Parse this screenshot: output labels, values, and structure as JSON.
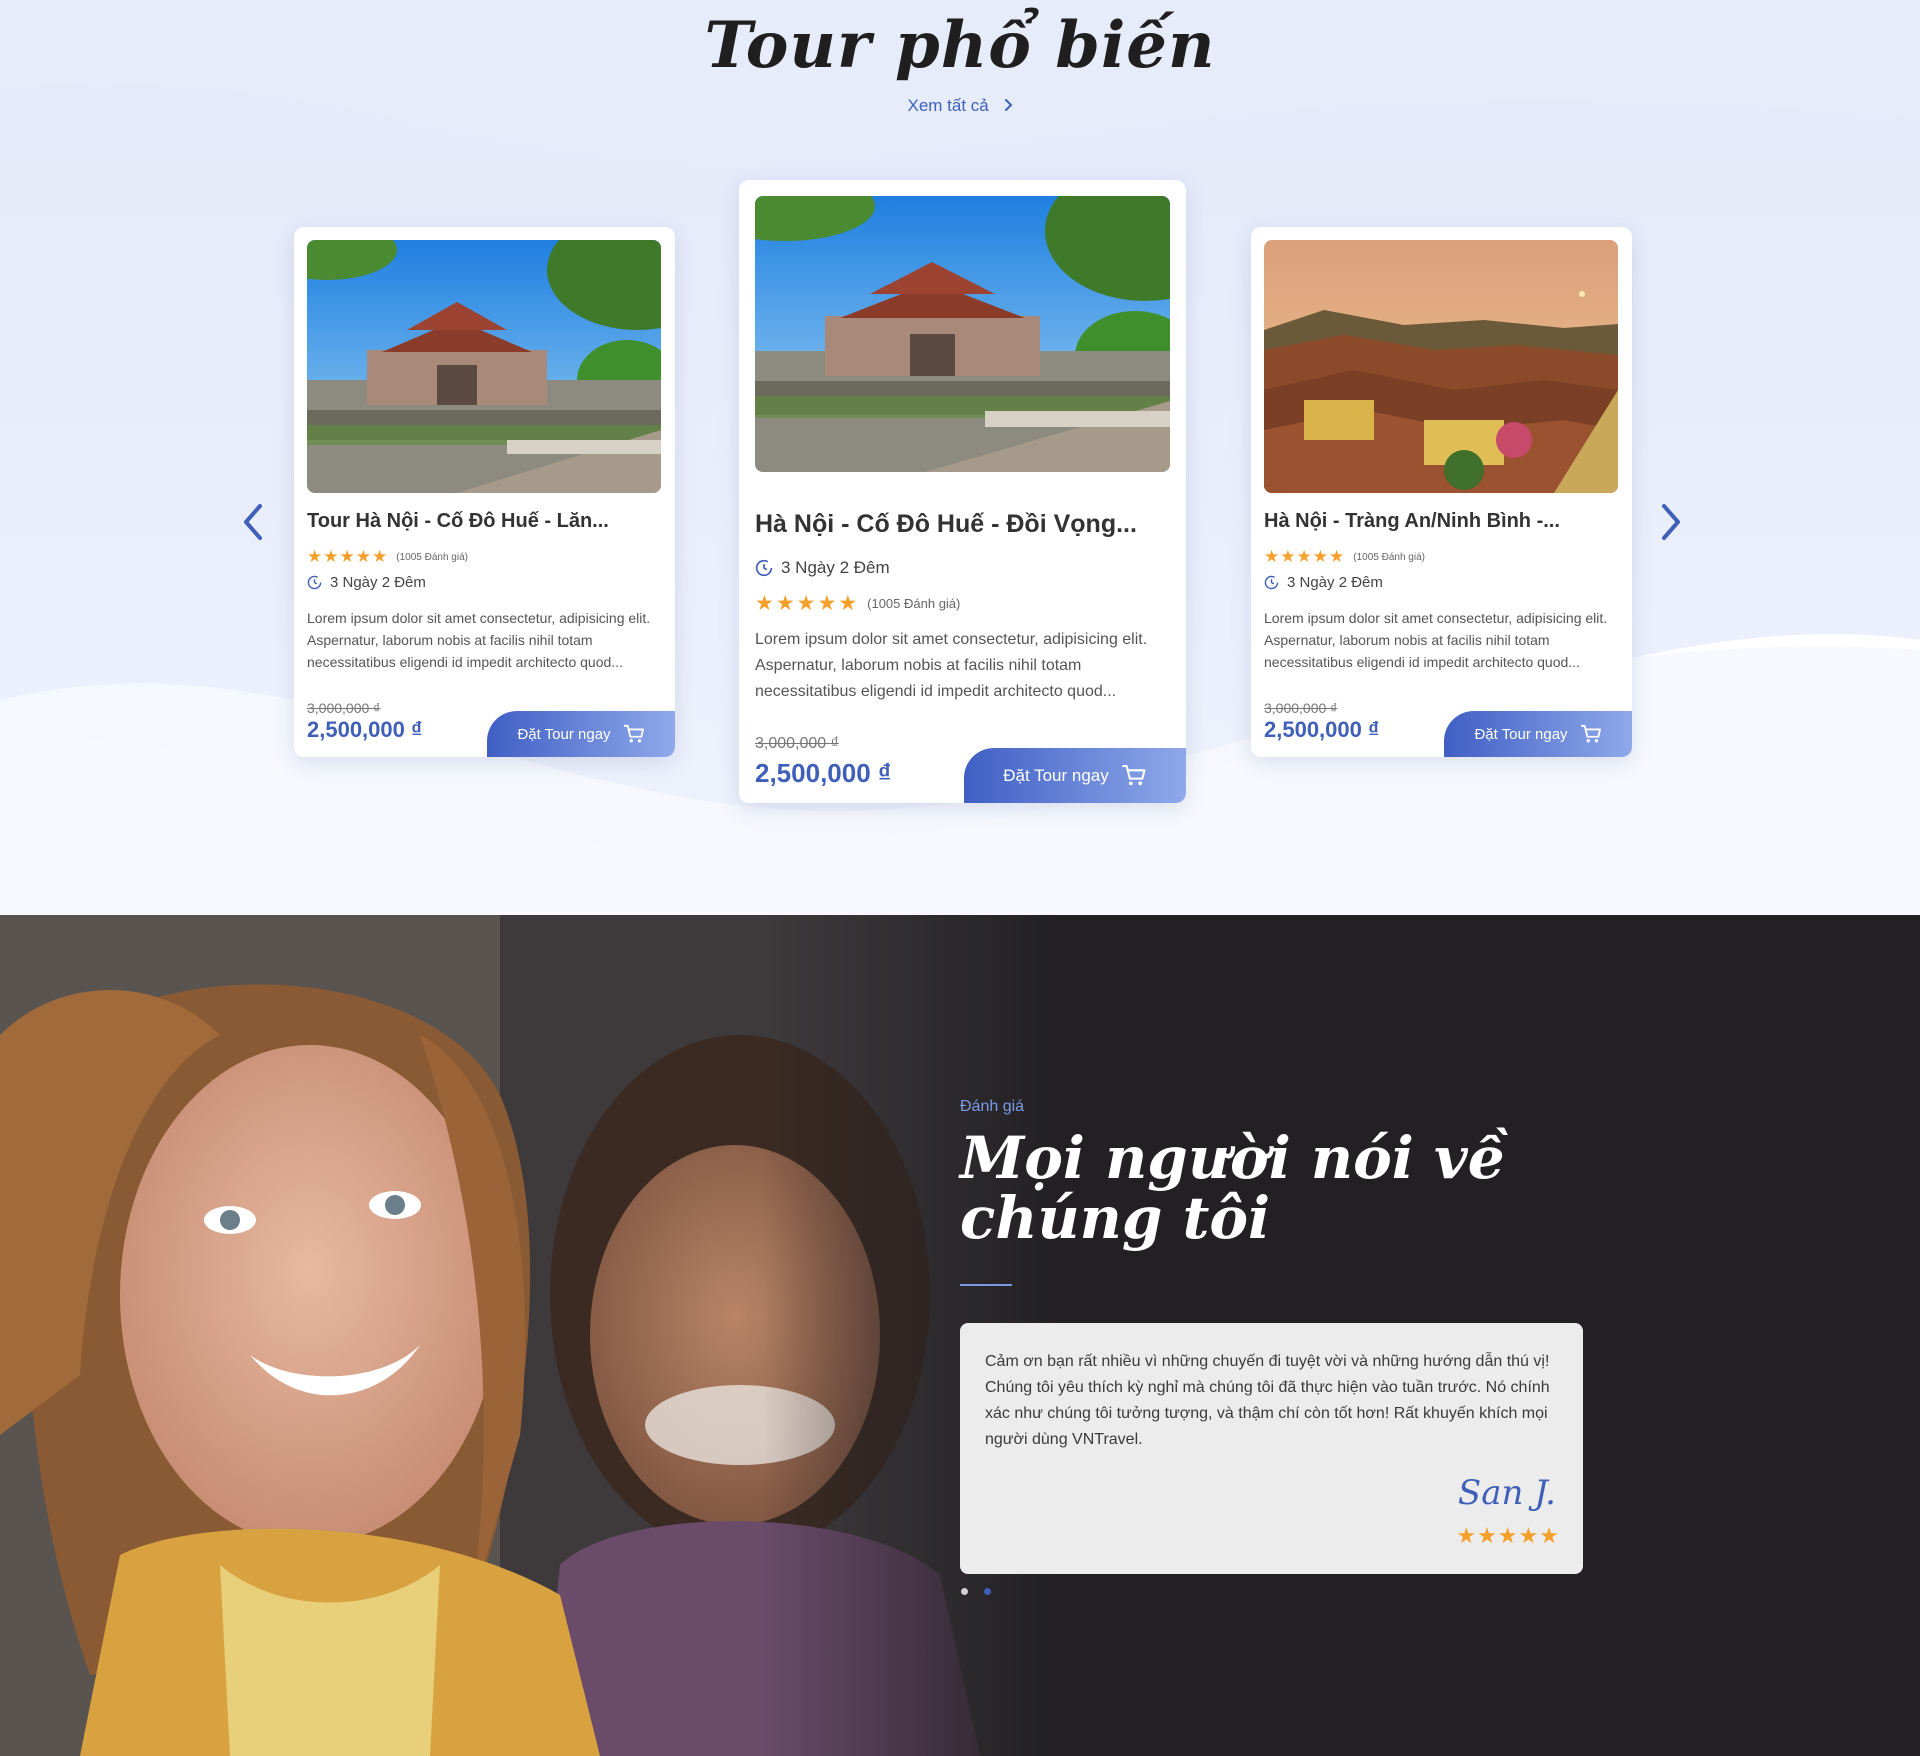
{
  "popular_tours": {
    "title": "Tour phổ biến",
    "view_all": "Xem tất cả",
    "cards": [
      {
        "title": "Tour Hà Nội - Cố Đô Huế - Lăn...",
        "rating": 5,
        "reviews": "(1005 Đánh giá)",
        "duration": "3 Ngày 2 Đêm",
        "description": "Lorem ipsum dolor sit amet consectetur, adipisicing elit. Aspernatur, laborum nobis at facilis nihil totam necessitatibus eligendi id impedit architecto quod...",
        "old_price": "3,000,000 ₫",
        "price": "2,500,000 ₫",
        "button": "Đặt Tour ngay",
        "image": "hue-imperial-citadel"
      },
      {
        "title": "Hà Nội - Cố Đô Huế - Đồi Vọng...",
        "rating": 5,
        "reviews": "(1005 Đánh giá)",
        "duration": "3 Ngày 2 Đêm",
        "description": "Lorem ipsum dolor sit amet consectetur, adipisicing elit. Aspernatur, laborum nobis at facilis nihil totam necessitatibus eligendi id impedit architecto quod...",
        "old_price": "3,000,000 ₫",
        "price": "2,500,000 ₫",
        "button": "Đặt Tour ngay",
        "image": "hue-imperial-citadel"
      },
      {
        "title": "Hà Nội - Tràng An/Ninh Bình -...",
        "rating": 5,
        "reviews": "(1005 Đánh giá)",
        "duration": "3 Ngày 2 Đêm",
        "description": "Lorem ipsum dolor sit amet consectetur, adipisicing elit. Aspernatur, laborum nobis at facilis nihil totam necessitatibus eligendi id impedit architecto quod...",
        "old_price": "3,000,000 ₫",
        "price": "2,500,000 ₫",
        "button": "Đặt Tour ngay",
        "image": "hoi-an-rooftops-sunset"
      }
    ],
    "icons": {
      "prev": "chevron-left-icon",
      "next": "chevron-right-icon",
      "duration": "clock-icon",
      "cart": "cart-icon",
      "star": "star-icon"
    }
  },
  "testimonials": {
    "eyebrow": "Đánh giá",
    "heading": "Mọi người nói về chúng tôi",
    "quote": "Cảm ơn bạn rất nhiều vì những chuyến đi tuyệt vời và những hướng dẫn thú vị! Chúng tôi yêu thích kỳ nghỉ mà chúng tôi đã thực hiện vào tuần trước. Nó chính xác như chúng tôi tưởng tượng, và thậm chí còn tốt hơn! Rất khuyến khích mọi người dùng VNTravel.",
    "author": "San J.",
    "rating": 5,
    "active_slide": 2,
    "slide_count": 2
  },
  "colors": {
    "accent": "#3f5fb8",
    "star": "#f5a02a",
    "section_bg_light": "#e9eefb",
    "testimonial_bg": "#232024"
  }
}
